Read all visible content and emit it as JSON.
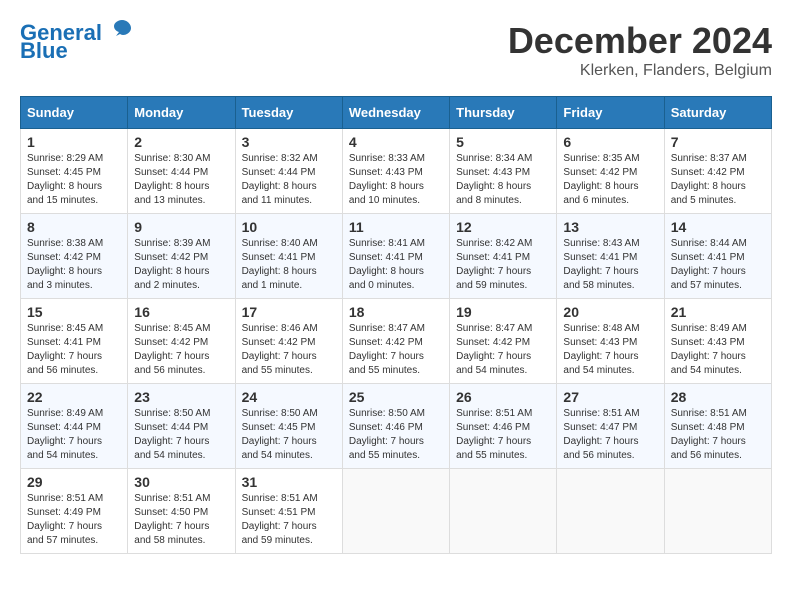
{
  "header": {
    "logo_line1": "General",
    "logo_line2": "Blue",
    "month_title": "December 2024",
    "location": "Klerken, Flanders, Belgium"
  },
  "weekdays": [
    "Sunday",
    "Monday",
    "Tuesday",
    "Wednesday",
    "Thursday",
    "Friday",
    "Saturday"
  ],
  "weeks": [
    [
      {
        "day": "1",
        "info": "Sunrise: 8:29 AM\nSunset: 4:45 PM\nDaylight: 8 hours\nand 15 minutes."
      },
      {
        "day": "2",
        "info": "Sunrise: 8:30 AM\nSunset: 4:44 PM\nDaylight: 8 hours\nand 13 minutes."
      },
      {
        "day": "3",
        "info": "Sunrise: 8:32 AM\nSunset: 4:44 PM\nDaylight: 8 hours\nand 11 minutes."
      },
      {
        "day": "4",
        "info": "Sunrise: 8:33 AM\nSunset: 4:43 PM\nDaylight: 8 hours\nand 10 minutes."
      },
      {
        "day": "5",
        "info": "Sunrise: 8:34 AM\nSunset: 4:43 PM\nDaylight: 8 hours\nand 8 minutes."
      },
      {
        "day": "6",
        "info": "Sunrise: 8:35 AM\nSunset: 4:42 PM\nDaylight: 8 hours\nand 6 minutes."
      },
      {
        "day": "7",
        "info": "Sunrise: 8:37 AM\nSunset: 4:42 PM\nDaylight: 8 hours\nand 5 minutes."
      }
    ],
    [
      {
        "day": "8",
        "info": "Sunrise: 8:38 AM\nSunset: 4:42 PM\nDaylight: 8 hours\nand 3 minutes."
      },
      {
        "day": "9",
        "info": "Sunrise: 8:39 AM\nSunset: 4:42 PM\nDaylight: 8 hours\nand 2 minutes."
      },
      {
        "day": "10",
        "info": "Sunrise: 8:40 AM\nSunset: 4:41 PM\nDaylight: 8 hours\nand 1 minute."
      },
      {
        "day": "11",
        "info": "Sunrise: 8:41 AM\nSunset: 4:41 PM\nDaylight: 8 hours\nand 0 minutes."
      },
      {
        "day": "12",
        "info": "Sunrise: 8:42 AM\nSunset: 4:41 PM\nDaylight: 7 hours\nand 59 minutes."
      },
      {
        "day": "13",
        "info": "Sunrise: 8:43 AM\nSunset: 4:41 PM\nDaylight: 7 hours\nand 58 minutes."
      },
      {
        "day": "14",
        "info": "Sunrise: 8:44 AM\nSunset: 4:41 PM\nDaylight: 7 hours\nand 57 minutes."
      }
    ],
    [
      {
        "day": "15",
        "info": "Sunrise: 8:45 AM\nSunset: 4:41 PM\nDaylight: 7 hours\nand 56 minutes."
      },
      {
        "day": "16",
        "info": "Sunrise: 8:45 AM\nSunset: 4:42 PM\nDaylight: 7 hours\nand 56 minutes."
      },
      {
        "day": "17",
        "info": "Sunrise: 8:46 AM\nSunset: 4:42 PM\nDaylight: 7 hours\nand 55 minutes."
      },
      {
        "day": "18",
        "info": "Sunrise: 8:47 AM\nSunset: 4:42 PM\nDaylight: 7 hours\nand 55 minutes."
      },
      {
        "day": "19",
        "info": "Sunrise: 8:47 AM\nSunset: 4:42 PM\nDaylight: 7 hours\nand 54 minutes."
      },
      {
        "day": "20",
        "info": "Sunrise: 8:48 AM\nSunset: 4:43 PM\nDaylight: 7 hours\nand 54 minutes."
      },
      {
        "day": "21",
        "info": "Sunrise: 8:49 AM\nSunset: 4:43 PM\nDaylight: 7 hours\nand 54 minutes."
      }
    ],
    [
      {
        "day": "22",
        "info": "Sunrise: 8:49 AM\nSunset: 4:44 PM\nDaylight: 7 hours\nand 54 minutes."
      },
      {
        "day": "23",
        "info": "Sunrise: 8:50 AM\nSunset: 4:44 PM\nDaylight: 7 hours\nand 54 minutes."
      },
      {
        "day": "24",
        "info": "Sunrise: 8:50 AM\nSunset: 4:45 PM\nDaylight: 7 hours\nand 54 minutes."
      },
      {
        "day": "25",
        "info": "Sunrise: 8:50 AM\nSunset: 4:46 PM\nDaylight: 7 hours\nand 55 minutes."
      },
      {
        "day": "26",
        "info": "Sunrise: 8:51 AM\nSunset: 4:46 PM\nDaylight: 7 hours\nand 55 minutes."
      },
      {
        "day": "27",
        "info": "Sunrise: 8:51 AM\nSunset: 4:47 PM\nDaylight: 7 hours\nand 56 minutes."
      },
      {
        "day": "28",
        "info": "Sunrise: 8:51 AM\nSunset: 4:48 PM\nDaylight: 7 hours\nand 56 minutes."
      }
    ],
    [
      {
        "day": "29",
        "info": "Sunrise: 8:51 AM\nSunset: 4:49 PM\nDaylight: 7 hours\nand 57 minutes."
      },
      {
        "day": "30",
        "info": "Sunrise: 8:51 AM\nSunset: 4:50 PM\nDaylight: 7 hours\nand 58 minutes."
      },
      {
        "day": "31",
        "info": "Sunrise: 8:51 AM\nSunset: 4:51 PM\nDaylight: 7 hours\nand 59 minutes."
      },
      {
        "day": "",
        "info": ""
      },
      {
        "day": "",
        "info": ""
      },
      {
        "day": "",
        "info": ""
      },
      {
        "day": "",
        "info": ""
      }
    ]
  ]
}
